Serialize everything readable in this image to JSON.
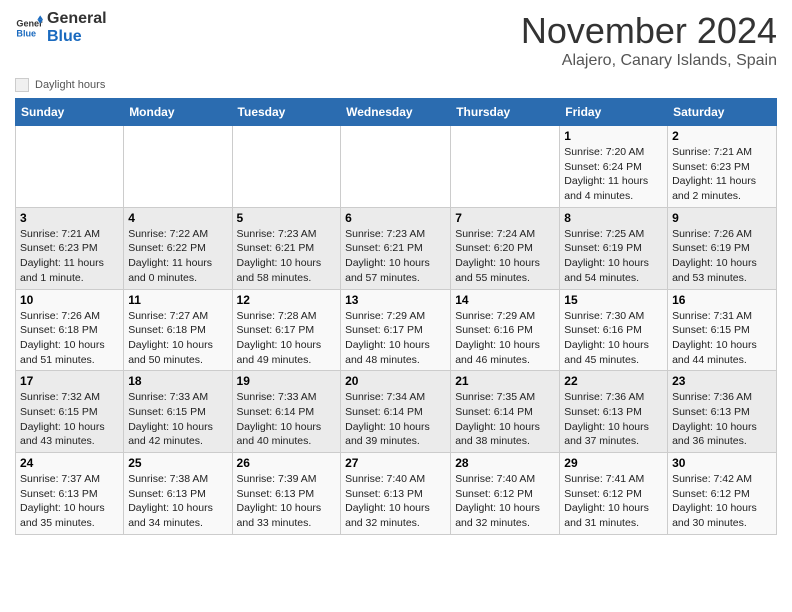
{
  "logo": {
    "line1": "General",
    "line2": "Blue"
  },
  "title": {
    "month": "November 2024",
    "location": "Alajero, Canary Islands, Spain"
  },
  "legend": {
    "label": "Daylight hours"
  },
  "headers": [
    "Sunday",
    "Monday",
    "Tuesday",
    "Wednesday",
    "Thursday",
    "Friday",
    "Saturday"
  ],
  "weeks": [
    {
      "days": [
        {
          "num": "",
          "info": ""
        },
        {
          "num": "",
          "info": ""
        },
        {
          "num": "",
          "info": ""
        },
        {
          "num": "",
          "info": ""
        },
        {
          "num": "",
          "info": ""
        },
        {
          "num": "1",
          "info": "Sunrise: 7:20 AM\nSunset: 6:24 PM\nDaylight: 11 hours and 4 minutes."
        },
        {
          "num": "2",
          "info": "Sunrise: 7:21 AM\nSunset: 6:23 PM\nDaylight: 11 hours and 2 minutes."
        }
      ]
    },
    {
      "days": [
        {
          "num": "3",
          "info": "Sunrise: 7:21 AM\nSunset: 6:23 PM\nDaylight: 11 hours and 1 minute."
        },
        {
          "num": "4",
          "info": "Sunrise: 7:22 AM\nSunset: 6:22 PM\nDaylight: 11 hours and 0 minutes."
        },
        {
          "num": "5",
          "info": "Sunrise: 7:23 AM\nSunset: 6:21 PM\nDaylight: 10 hours and 58 minutes."
        },
        {
          "num": "6",
          "info": "Sunrise: 7:23 AM\nSunset: 6:21 PM\nDaylight: 10 hours and 57 minutes."
        },
        {
          "num": "7",
          "info": "Sunrise: 7:24 AM\nSunset: 6:20 PM\nDaylight: 10 hours and 55 minutes."
        },
        {
          "num": "8",
          "info": "Sunrise: 7:25 AM\nSunset: 6:19 PM\nDaylight: 10 hours and 54 minutes."
        },
        {
          "num": "9",
          "info": "Sunrise: 7:26 AM\nSunset: 6:19 PM\nDaylight: 10 hours and 53 minutes."
        }
      ]
    },
    {
      "days": [
        {
          "num": "10",
          "info": "Sunrise: 7:26 AM\nSunset: 6:18 PM\nDaylight: 10 hours and 51 minutes."
        },
        {
          "num": "11",
          "info": "Sunrise: 7:27 AM\nSunset: 6:18 PM\nDaylight: 10 hours and 50 minutes."
        },
        {
          "num": "12",
          "info": "Sunrise: 7:28 AM\nSunset: 6:17 PM\nDaylight: 10 hours and 49 minutes."
        },
        {
          "num": "13",
          "info": "Sunrise: 7:29 AM\nSunset: 6:17 PM\nDaylight: 10 hours and 48 minutes."
        },
        {
          "num": "14",
          "info": "Sunrise: 7:29 AM\nSunset: 6:16 PM\nDaylight: 10 hours and 46 minutes."
        },
        {
          "num": "15",
          "info": "Sunrise: 7:30 AM\nSunset: 6:16 PM\nDaylight: 10 hours and 45 minutes."
        },
        {
          "num": "16",
          "info": "Sunrise: 7:31 AM\nSunset: 6:15 PM\nDaylight: 10 hours and 44 minutes."
        }
      ]
    },
    {
      "days": [
        {
          "num": "17",
          "info": "Sunrise: 7:32 AM\nSunset: 6:15 PM\nDaylight: 10 hours and 43 minutes."
        },
        {
          "num": "18",
          "info": "Sunrise: 7:33 AM\nSunset: 6:15 PM\nDaylight: 10 hours and 42 minutes."
        },
        {
          "num": "19",
          "info": "Sunrise: 7:33 AM\nSunset: 6:14 PM\nDaylight: 10 hours and 40 minutes."
        },
        {
          "num": "20",
          "info": "Sunrise: 7:34 AM\nSunset: 6:14 PM\nDaylight: 10 hours and 39 minutes."
        },
        {
          "num": "21",
          "info": "Sunrise: 7:35 AM\nSunset: 6:14 PM\nDaylight: 10 hours and 38 minutes."
        },
        {
          "num": "22",
          "info": "Sunrise: 7:36 AM\nSunset: 6:13 PM\nDaylight: 10 hours and 37 minutes."
        },
        {
          "num": "23",
          "info": "Sunrise: 7:36 AM\nSunset: 6:13 PM\nDaylight: 10 hours and 36 minutes."
        }
      ]
    },
    {
      "days": [
        {
          "num": "24",
          "info": "Sunrise: 7:37 AM\nSunset: 6:13 PM\nDaylight: 10 hours and 35 minutes."
        },
        {
          "num": "25",
          "info": "Sunrise: 7:38 AM\nSunset: 6:13 PM\nDaylight: 10 hours and 34 minutes."
        },
        {
          "num": "26",
          "info": "Sunrise: 7:39 AM\nSunset: 6:13 PM\nDaylight: 10 hours and 33 minutes."
        },
        {
          "num": "27",
          "info": "Sunrise: 7:40 AM\nSunset: 6:13 PM\nDaylight: 10 hours and 32 minutes."
        },
        {
          "num": "28",
          "info": "Sunrise: 7:40 AM\nSunset: 6:12 PM\nDaylight: 10 hours and 32 minutes."
        },
        {
          "num": "29",
          "info": "Sunrise: 7:41 AM\nSunset: 6:12 PM\nDaylight: 10 hours and 31 minutes."
        },
        {
          "num": "30",
          "info": "Sunrise: 7:42 AM\nSunset: 6:12 PM\nDaylight: 10 hours and 30 minutes."
        }
      ]
    }
  ]
}
